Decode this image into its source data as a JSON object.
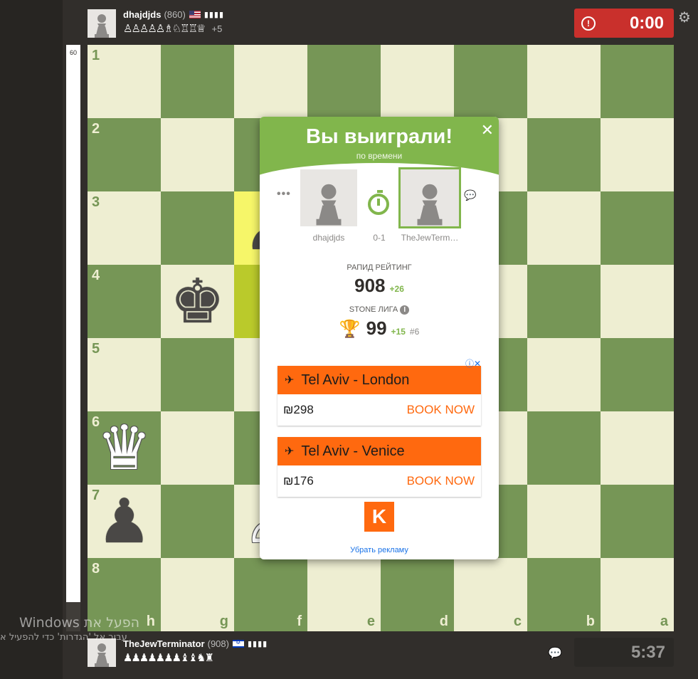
{
  "top_player": {
    "name": "dhajdjds",
    "rating": "(860)",
    "bars": "▮▮▮▮",
    "captured": "♙♙♙♙♙♗♘♖♖♕",
    "advantage": "+5"
  },
  "bottom_player": {
    "name": "TheJewTerminator",
    "rating": "(908)",
    "bars": "▮▮▮▮",
    "captured": "♟♟♟♟♟♟♟♝♝♞♜"
  },
  "clocks": {
    "top_time": "0:00",
    "bottom_time": "5:37"
  },
  "eval": {
    "score": "60",
    "white_fraction": 0.95
  },
  "board": {
    "ranks": [
      "1",
      "2",
      "3",
      "4",
      "5",
      "6",
      "7",
      "8"
    ],
    "files": [
      "h",
      "g",
      "f",
      "e",
      "d",
      "c",
      "b",
      "a"
    ],
    "pieces": [
      {
        "square": "g4",
        "glyph": "♚",
        "color": "black"
      },
      {
        "square": "h6",
        "glyph": "♛",
        "color": "white"
      },
      {
        "square": "h7",
        "glyph": "♟",
        "color": "black"
      },
      {
        "square": "f3",
        "glyph": "♟",
        "color": "black"
      },
      {
        "square": "f7",
        "glyph": "♙",
        "color": "white"
      }
    ],
    "highlighted": [
      "f3",
      "f4"
    ]
  },
  "modal": {
    "title": "Вы выиграли!",
    "subtitle": "по времени",
    "player1": "dhajdjds",
    "player2": "TheJewTerm…",
    "result": "0-1",
    "rating_label": "РАПИД РЕЙТИНГ",
    "rating_value": "908",
    "rating_delta": "+26",
    "league_label": "STONE ЛИГА",
    "league_value": "99",
    "league_delta": "+15",
    "league_rank": "#6",
    "remove_ads": "Убрать рекламу"
  },
  "ads": [
    {
      "route": "Tel Aviv - London",
      "price": "₪298",
      "cta": "BOOK NOW"
    },
    {
      "route": "Tel Aviv - Venice",
      "price": "₪176",
      "cta": "BOOK NOW"
    }
  ],
  "ad_brand": "K",
  "watermark": {
    "line1": "Windows הפעל את",
    "line2": "עבור אל 'הגדרות' כדי להפעיל א"
  },
  "colors": {
    "light_square": "#eeeed2",
    "dark_square": "#769656",
    "accent_green": "#81b64c",
    "clock_red": "#c9302c",
    "ad_orange": "#ff690f"
  }
}
